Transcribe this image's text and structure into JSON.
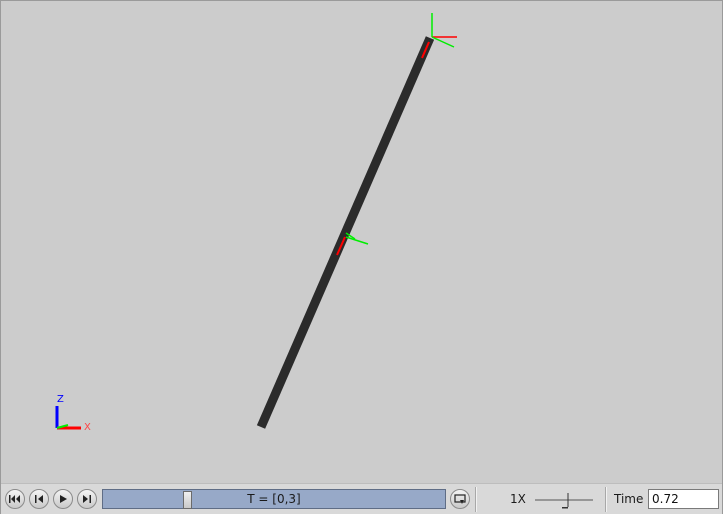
{
  "viewport": {
    "background": "#cccccc",
    "link_color": "#2b2b2b",
    "frame_x_color": "#ff0000",
    "frame_y_color": "#00ee00",
    "frame_z_color": "#0000ff",
    "axis_triad": {
      "z_label": "Z",
      "x_label": "X"
    }
  },
  "playback": {
    "buttons": [
      {
        "name": "skip-to-start",
        "icon": "skip-start-icon"
      },
      {
        "name": "step-back",
        "icon": "step-back-icon"
      },
      {
        "name": "play",
        "icon": "play-icon"
      },
      {
        "name": "step-forward",
        "icon": "step-forward-icon"
      }
    ],
    "time_range_label": "T = [0,3]",
    "time_fraction": 0.24,
    "loop_icon": "loop-icon",
    "speed_label": "1X",
    "time_label": "Time",
    "time_value": "0.72"
  }
}
